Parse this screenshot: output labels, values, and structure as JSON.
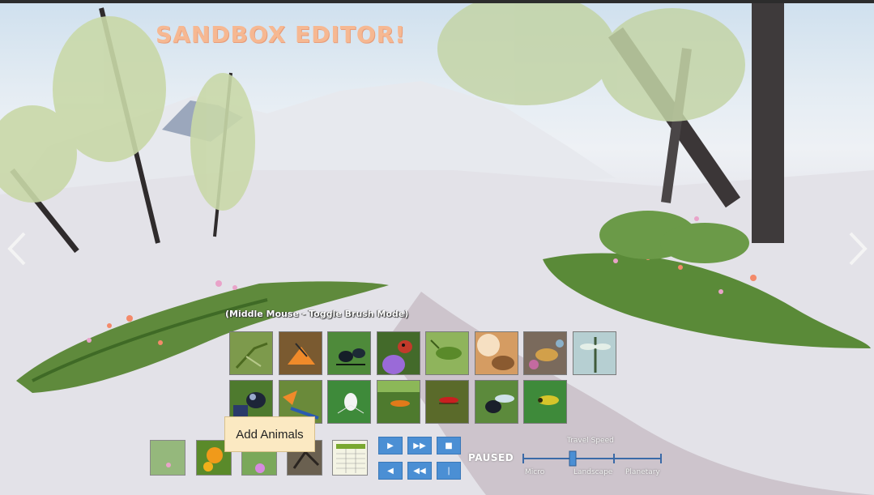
{
  "title": "SANDBOX EDITOR!",
  "hint": "(Middle Mouse - Toggle Brush Mode)",
  "tooltip": "Add Animals",
  "status": "PAUSED",
  "travel_speed": {
    "label": "Travel Speed",
    "ticks": [
      "Micro",
      "Landscape",
      "Planetary"
    ]
  },
  "animals_row1": [
    "mantis",
    "butterfly",
    "ant",
    "ladybug",
    "grasshopper",
    "moth",
    "wasp",
    "dragonfly"
  ],
  "animals_row2": [
    "beetle",
    "damselfly",
    "spider",
    "orange-ant",
    "red-ant",
    "fly",
    "yellow-bug"
  ],
  "colors": {
    "accent": "#4b8fd4",
    "title": "#f6b892",
    "tooltip": "#fbe9c2"
  }
}
